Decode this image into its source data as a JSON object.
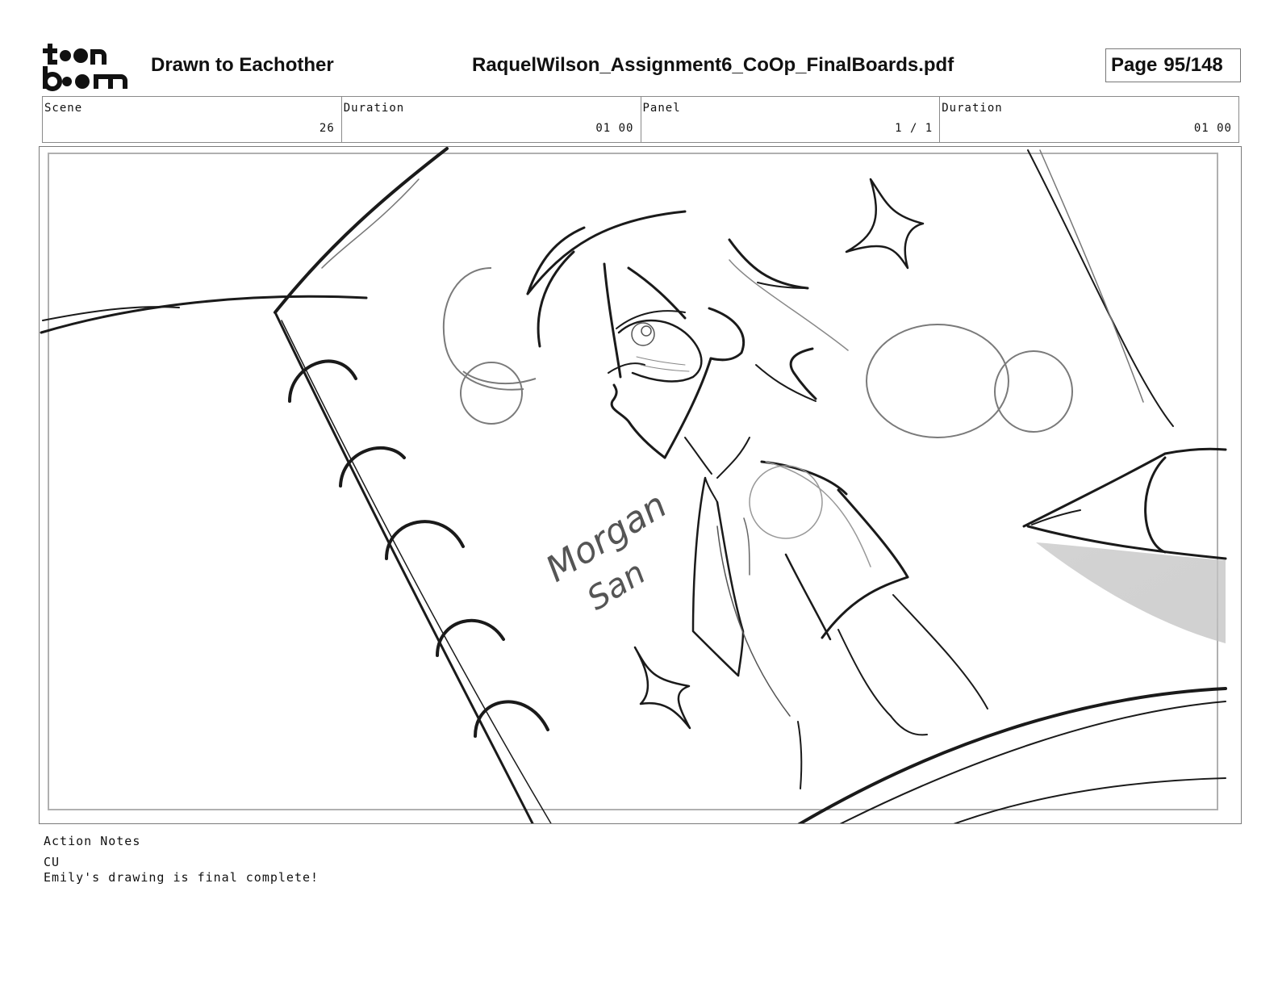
{
  "header": {
    "logo_text_top": "toon",
    "logo_text_bottom": "boom",
    "project_title": "Drawn to Eachother",
    "file_name": "RaquelWilson_Assignment6_CoOp_FinalBoards.pdf",
    "page_label": "Page",
    "page_value": "95/148"
  },
  "info": {
    "scene_label": "Scene",
    "scene_value": "26",
    "scene_duration_label": "Duration",
    "scene_duration_value": "01 00",
    "panel_label": "Panel",
    "panel_value": "1 / 1",
    "panel_duration_label": "Duration",
    "panel_duration_value": "01 00"
  },
  "drawing": {
    "signature_line1": "Morgan",
    "signature_line2": "San"
  },
  "notes": {
    "label": "Action Notes",
    "lines": [
      "CU",
      "Emily's drawing is final complete!"
    ]
  }
}
